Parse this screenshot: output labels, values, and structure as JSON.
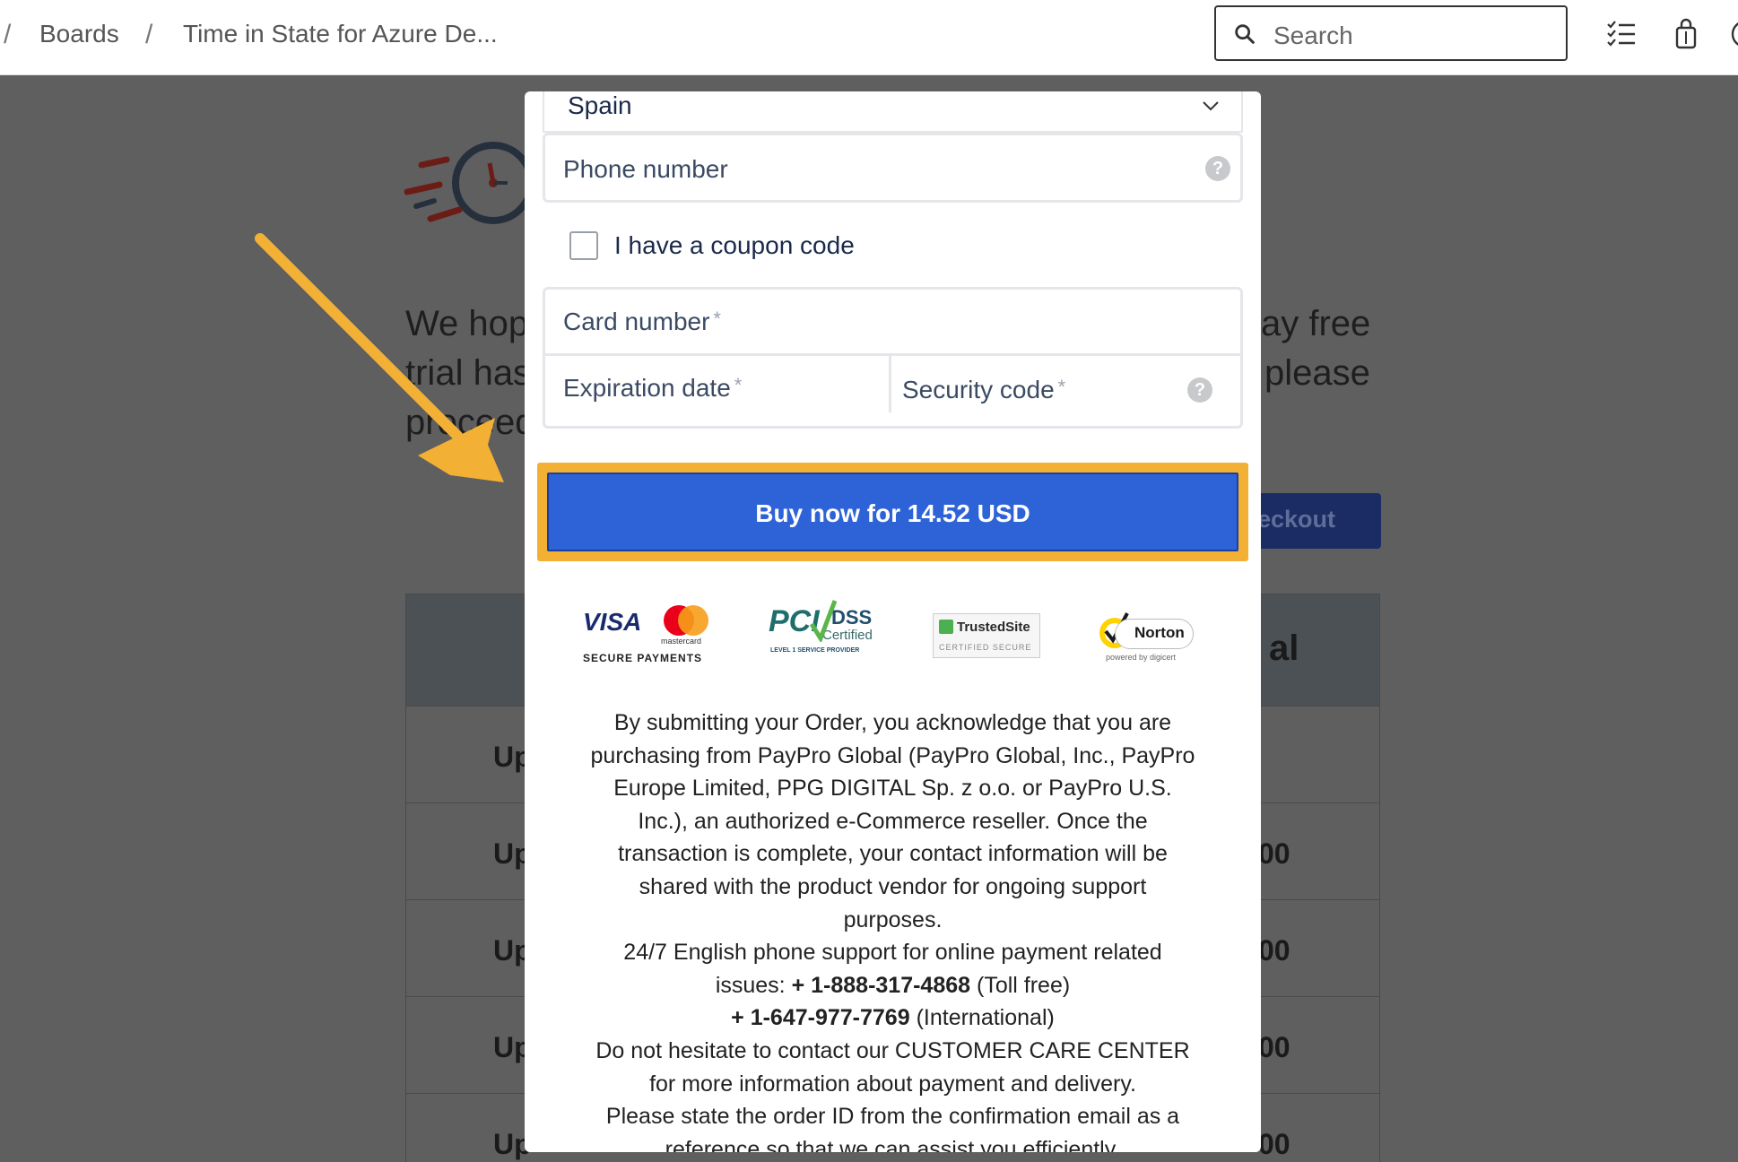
{
  "topbar": {
    "breadcrumb_sep": "/",
    "breadcrumb_1": "Boards",
    "breadcrumb_2": "Time in State for Azure De...",
    "search_placeholder": "Search"
  },
  "background": {
    "text_line1_left": "We hop",
    "text_line1_right": "ay free",
    "text_line2_left": "trial has",
    "text_line2_right": "please",
    "text_line3_left": "proceed",
    "checkout_label": "eckout",
    "header_fragment": "al",
    "rows": [
      {
        "left": "Up",
        "right": ""
      },
      {
        "left": "Up",
        "right": "00"
      },
      {
        "left": "Up",
        "right": "00"
      },
      {
        "left": "Up",
        "right": "00"
      },
      {
        "left": "Up",
        "right": "00"
      }
    ]
  },
  "form": {
    "country_value": "Spain",
    "phone_placeholder": "Phone number",
    "coupon_label": "I have a coupon code",
    "card_number_label": "Card number",
    "expiration_label": "Expiration date",
    "security_code_label": "Security code",
    "required_mark": "*",
    "help_mark": "?",
    "buy_button": "Buy now for 14.52 USD"
  },
  "badges": {
    "visa": "VISA",
    "secure_payments": "SECURE PAYMENTS",
    "mastercard": "mastercard",
    "pci": "PCI",
    "dss": "DSS",
    "certified": "Certified",
    "pci_sub": "LEVEL 1 SERVICE PROVIDER",
    "trusted_site": "TrustedSite",
    "certified_secure": "CERTIFIED SECURE",
    "norton": "Norton",
    "powered_by": "powered by digicert"
  },
  "legal": {
    "p1": "By submitting your Order, you acknowledge that you are purchasing from PayPro Global (PayPro Global, Inc., PayPro Europe Limited, PPG DIGITAL Sp. z o.o. or PayPro U.S. Inc.), an authorized e-Commerce reseller. Once the transaction is complete, your contact information will be shared with the product vendor for ongoing support purposes.",
    "p2_prefix": "24/7 English phone support for online payment related issues: ",
    "phone_tollfree": "+ 1-888-317-4868",
    "tollfree_label": " (Toll free)",
    "phone_intl": "+ 1-647-977-7769",
    "intl_label": " (International)",
    "p3": "Do not hesitate to contact our CUSTOMER CARE CENTER for more information about payment and delivery.",
    "p4": "Please state the order ID from the confirmation email as a reference so that we can assist you efficiently."
  },
  "colors": {
    "accent": "#2e63d8",
    "highlight": "#f2b134",
    "backdrop": "#5f5f5f"
  }
}
